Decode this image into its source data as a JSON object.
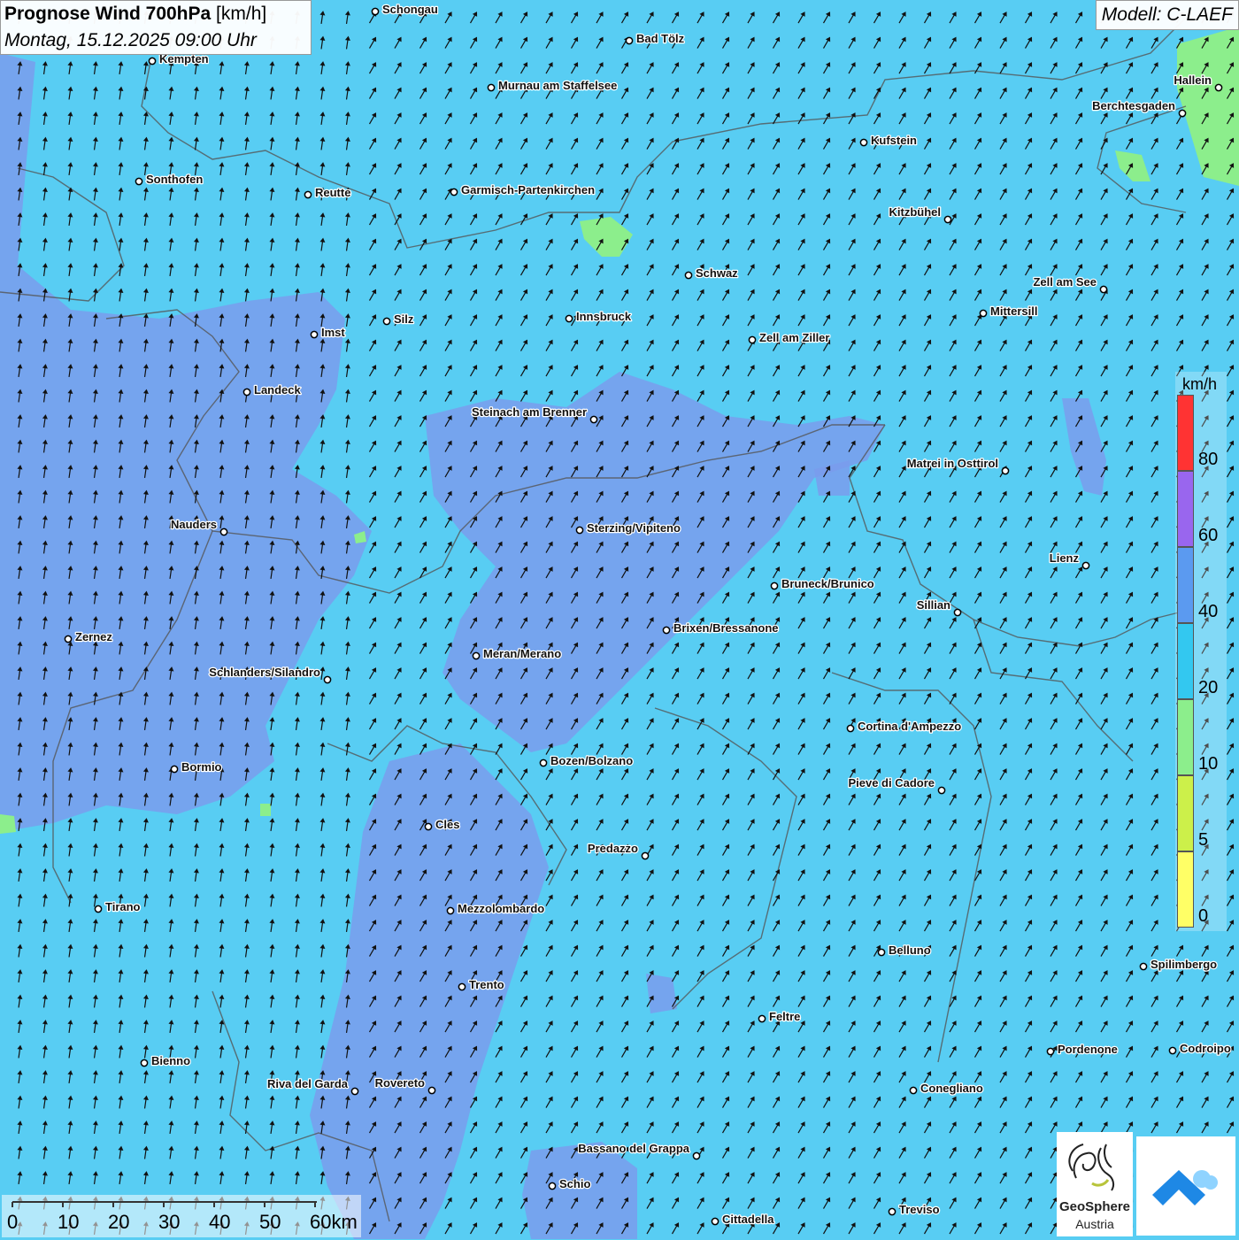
{
  "header": {
    "title_bold": "Prognose Wind 700hPa",
    "title_unit": " [km/h]",
    "datetime": "Montag, 15.12.2025 09:00 Uhr",
    "model": "Modell: C-LAEF"
  },
  "legend": {
    "unit": "km/h",
    "colors": [
      "#ffff66",
      "#ccf04a",
      "#8cee8c",
      "#33c8f0",
      "#5b9af0",
      "#9966ee",
      "#ff3333"
    ],
    "labels": [
      "0",
      "5",
      "10",
      "20",
      "40",
      "60",
      "80"
    ]
  },
  "scale_bar": {
    "labels": [
      "0",
      "10",
      "20",
      "30",
      "40",
      "50",
      "60km"
    ]
  },
  "wind_field": {
    "direction": "north-northeast",
    "arrow_color": "#111111",
    "background_color": "#58cdf3",
    "strong_wind_color": "#7a9cec"
  },
  "cities": [
    {
      "name": "Schongau"
    },
    {
      "name": "Bad Tölz"
    },
    {
      "name": "Kempten"
    },
    {
      "name": "Murnau am Staffelsee"
    },
    {
      "name": "Hallein"
    },
    {
      "name": "Berchtesgaden"
    },
    {
      "name": "Kufstein"
    },
    {
      "name": "Sonthofen"
    },
    {
      "name": "Reutte"
    },
    {
      "name": "Garmisch-Partenkirchen"
    },
    {
      "name": "Kitzbühel"
    },
    {
      "name": "Schwaz"
    },
    {
      "name": "Zell am See"
    },
    {
      "name": "Mittersill"
    },
    {
      "name": "Innsbruck"
    },
    {
      "name": "Silz"
    },
    {
      "name": "Imst"
    },
    {
      "name": "Zell am Ziller"
    },
    {
      "name": "Landeck"
    },
    {
      "name": "Steinach am Brenner"
    },
    {
      "name": "Matrei in Osttirol"
    },
    {
      "name": "Nauders"
    },
    {
      "name": "Sterzing/Vipiteno"
    },
    {
      "name": "Lienz"
    },
    {
      "name": "Bruneck/Brunico"
    },
    {
      "name": "Sillian"
    },
    {
      "name": "Brixen/Bressanone"
    },
    {
      "name": "Zernez"
    },
    {
      "name": "Meran/Merano"
    },
    {
      "name": "Schlanders/Silandro"
    },
    {
      "name": "Cortina d'Ampezzo"
    },
    {
      "name": "Bozen/Bolzano"
    },
    {
      "name": "Bormio"
    },
    {
      "name": "Pieve di Cadore"
    },
    {
      "name": "Cles"
    },
    {
      "name": "Predazzo"
    },
    {
      "name": "Tirano"
    },
    {
      "name": "Mezzolombardo"
    },
    {
      "name": "Belluno"
    },
    {
      "name": "Spilimbergo"
    },
    {
      "name": "Trento"
    },
    {
      "name": "Feltre"
    },
    {
      "name": "Pordenone"
    },
    {
      "name": "Codroipo"
    },
    {
      "name": "Bienno"
    },
    {
      "name": "Riva del Garda"
    },
    {
      "name": "Rovereto"
    },
    {
      "name": "Conegliano"
    },
    {
      "name": "Bassano del Grappa"
    },
    {
      "name": "Schio"
    },
    {
      "name": "Treviso"
    },
    {
      "name": "Cittadella"
    }
  ],
  "logos": {
    "geosphere_line1": "GeoSphere",
    "geosphere_line2": "Austria"
  }
}
